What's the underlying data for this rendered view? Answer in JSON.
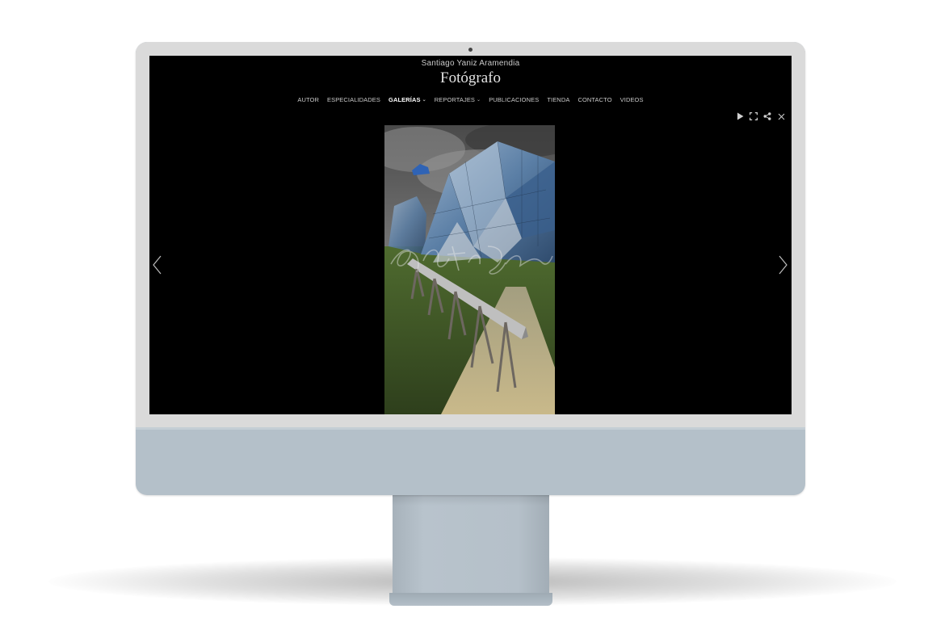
{
  "site": {
    "author": "Santiago Yaniz Aramendia",
    "title": "Fotógrafo"
  },
  "nav": {
    "items": [
      {
        "label": "AUTOR",
        "active": false,
        "dropdown": false
      },
      {
        "label": "ESPECIALIDADES",
        "active": false,
        "dropdown": false
      },
      {
        "label": "GALERÍAS",
        "active": true,
        "dropdown": true
      },
      {
        "label": "REPORTAJES",
        "active": false,
        "dropdown": true
      },
      {
        "label": "PUBLICACIONES",
        "active": false,
        "dropdown": false
      },
      {
        "label": "TIENDA",
        "active": false,
        "dropdown": false
      },
      {
        "label": "CONTACTO",
        "active": false,
        "dropdown": false
      },
      {
        "label": "VIDEOS",
        "active": false,
        "dropdown": false
      }
    ],
    "caret_glyph": "⌄"
  },
  "lightbox": {
    "tools": [
      "play-icon",
      "fullscreen-icon",
      "share-icon",
      "close-icon"
    ],
    "prev_icon": "chevron-left-icon",
    "next_icon": "chevron-right-icon",
    "watermark_present": true
  },
  "colors": {
    "screen_bg": "#000000",
    "bezel": "#dadada",
    "chassis": "#b4c0c9",
    "nav_text": "#c9c9c9",
    "nav_active": "#ffffff"
  }
}
